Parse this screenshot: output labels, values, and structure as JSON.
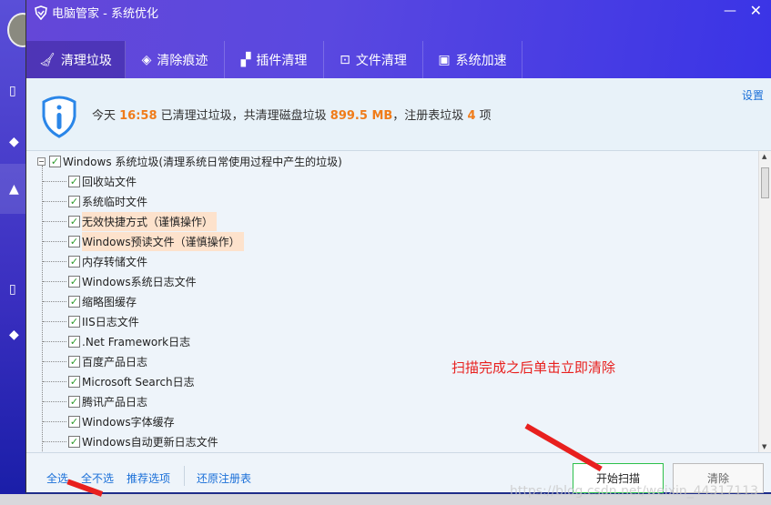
{
  "window": {
    "title": "电脑管家 - 系统优化",
    "minimize": "—",
    "close": "✕"
  },
  "tabs": [
    {
      "label": "清理垃圾",
      "icon": "broom-icon",
      "active": true
    },
    {
      "label": "清除痕迹",
      "icon": "eraser-icon"
    },
    {
      "label": "插件清理",
      "icon": "plugin-icon"
    },
    {
      "label": "文件清理",
      "icon": "trash-icon"
    },
    {
      "label": "系统加速",
      "icon": "monitor-icon"
    }
  ],
  "info": {
    "p1": "今天 ",
    "time": "16:58",
    "p2": " 已清理过垃圾，共清理磁盘垃圾 ",
    "size": "899.5 MB",
    "p3": "，注册表垃圾 ",
    "count": "4",
    "p4": " 项",
    "settings": "设置"
  },
  "tree": {
    "root": "Windows 系统垃圾(清理系统日常使用过程中产生的垃圾)",
    "items": [
      "回收站文件",
      "系统临时文件",
      "无效快捷方式（谨慎操作）",
      "Windows预读文件（谨慎操作）",
      "内存转储文件",
      "Windows系统日志文件",
      "缩略图缓存",
      "IIS日志文件",
      ".Net Framework日志",
      "百度产品日志",
      "Microsoft Search日志",
      "腾讯产品日志",
      "Windows字体缓存",
      "Windows自动更新日志文件"
    ]
  },
  "annotation": "扫描完成之后单击立即清除",
  "footer": {
    "select_all": "全选",
    "select_none": "全不选",
    "recommended": "推荐选项",
    "restore_registry": "还原注册表",
    "scan": "开始扫描",
    "clean": "清除"
  },
  "watermark": "https://blog.csdn.net/weixin_44317113",
  "colors": {
    "accent": "#f07c1a",
    "link": "#1a6fd8",
    "header": "#5a48e0"
  }
}
